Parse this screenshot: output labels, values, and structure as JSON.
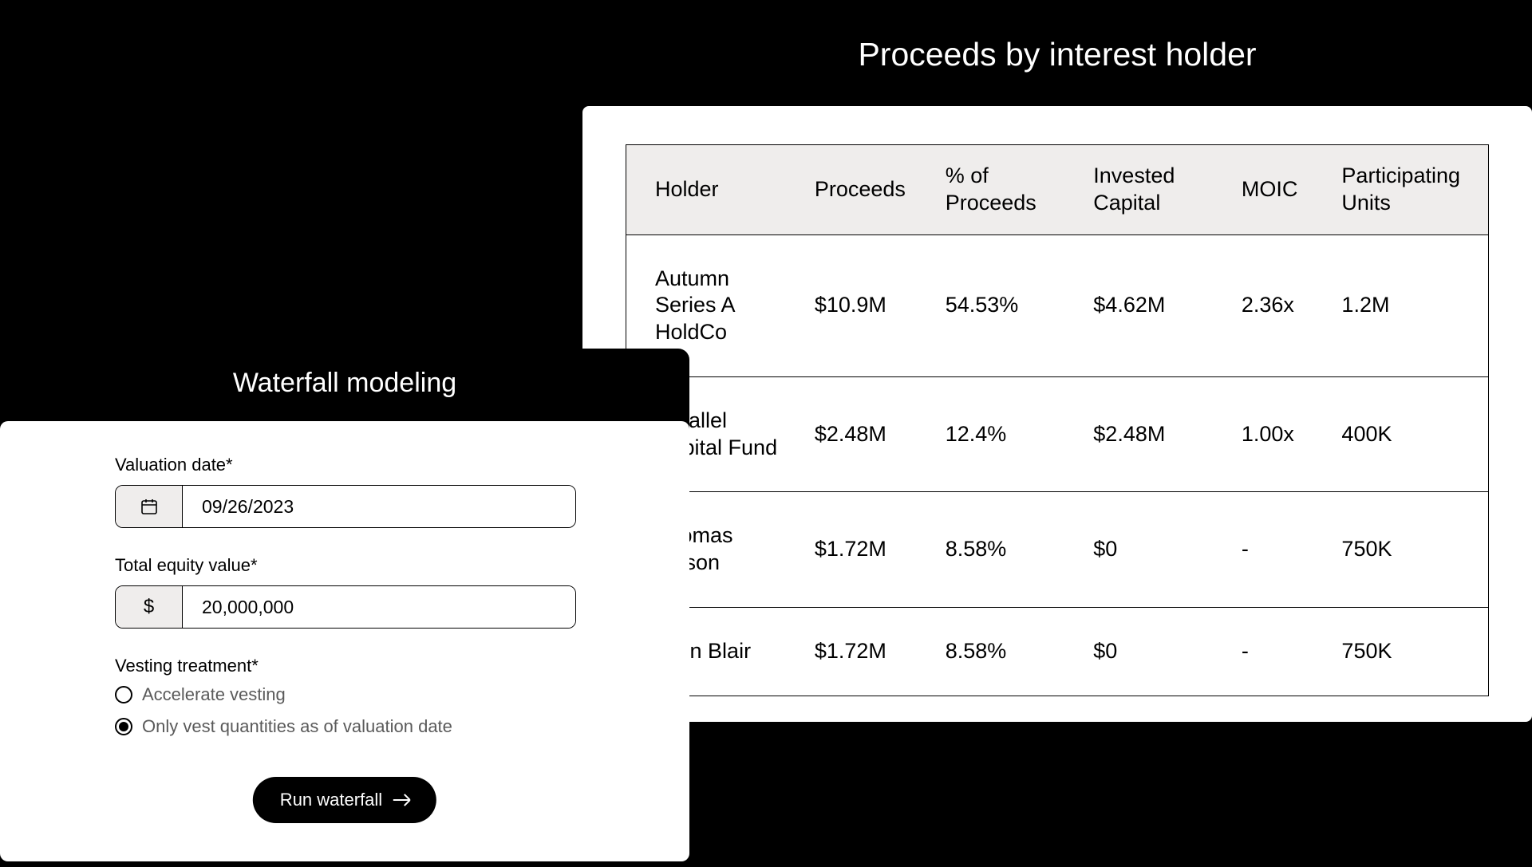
{
  "proceeds": {
    "title": "Proceeds by interest holder",
    "columns": [
      "Holder",
      "Proceeds",
      "% of Proceeds",
      "Invested Capital",
      "MOIC",
      "Participating Units"
    ],
    "rows": [
      {
        "holder": "Autumn Series A HoldCo",
        "proceeds": "$10.9M",
        "pct": "54.53%",
        "invested": "$4.62M",
        "moic": "2.36x",
        "units": "1.2M"
      },
      {
        "holder": "Parallel Capital Fund",
        "proceeds": "$2.48M",
        "pct": "12.4%",
        "invested": "$2.48M",
        "moic": "1.00x",
        "units": "400K"
      },
      {
        "holder": "Thomas Mason",
        "proceeds": "$1.72M",
        "pct": "8.58%",
        "invested": "$0",
        "moic": "-",
        "units": "750K"
      },
      {
        "holder": "John Blair",
        "proceeds": "$1.72M",
        "pct": "8.58%",
        "invested": "$0",
        "moic": "-",
        "units": "750K"
      }
    ]
  },
  "waterfall": {
    "title": "Waterfall modeling",
    "valuation_date_label": "Valuation date*",
    "valuation_date_value": "09/26/2023",
    "total_equity_label": "Total equity value*",
    "total_equity_value": "20,000,000",
    "currency_symbol": "$",
    "vesting_label": "Vesting treatment*",
    "vesting_options": [
      {
        "label": "Accelerate vesting",
        "selected": false
      },
      {
        "label": "Only vest quantities as of valuation date",
        "selected": true
      }
    ],
    "run_label": "Run waterfall"
  }
}
